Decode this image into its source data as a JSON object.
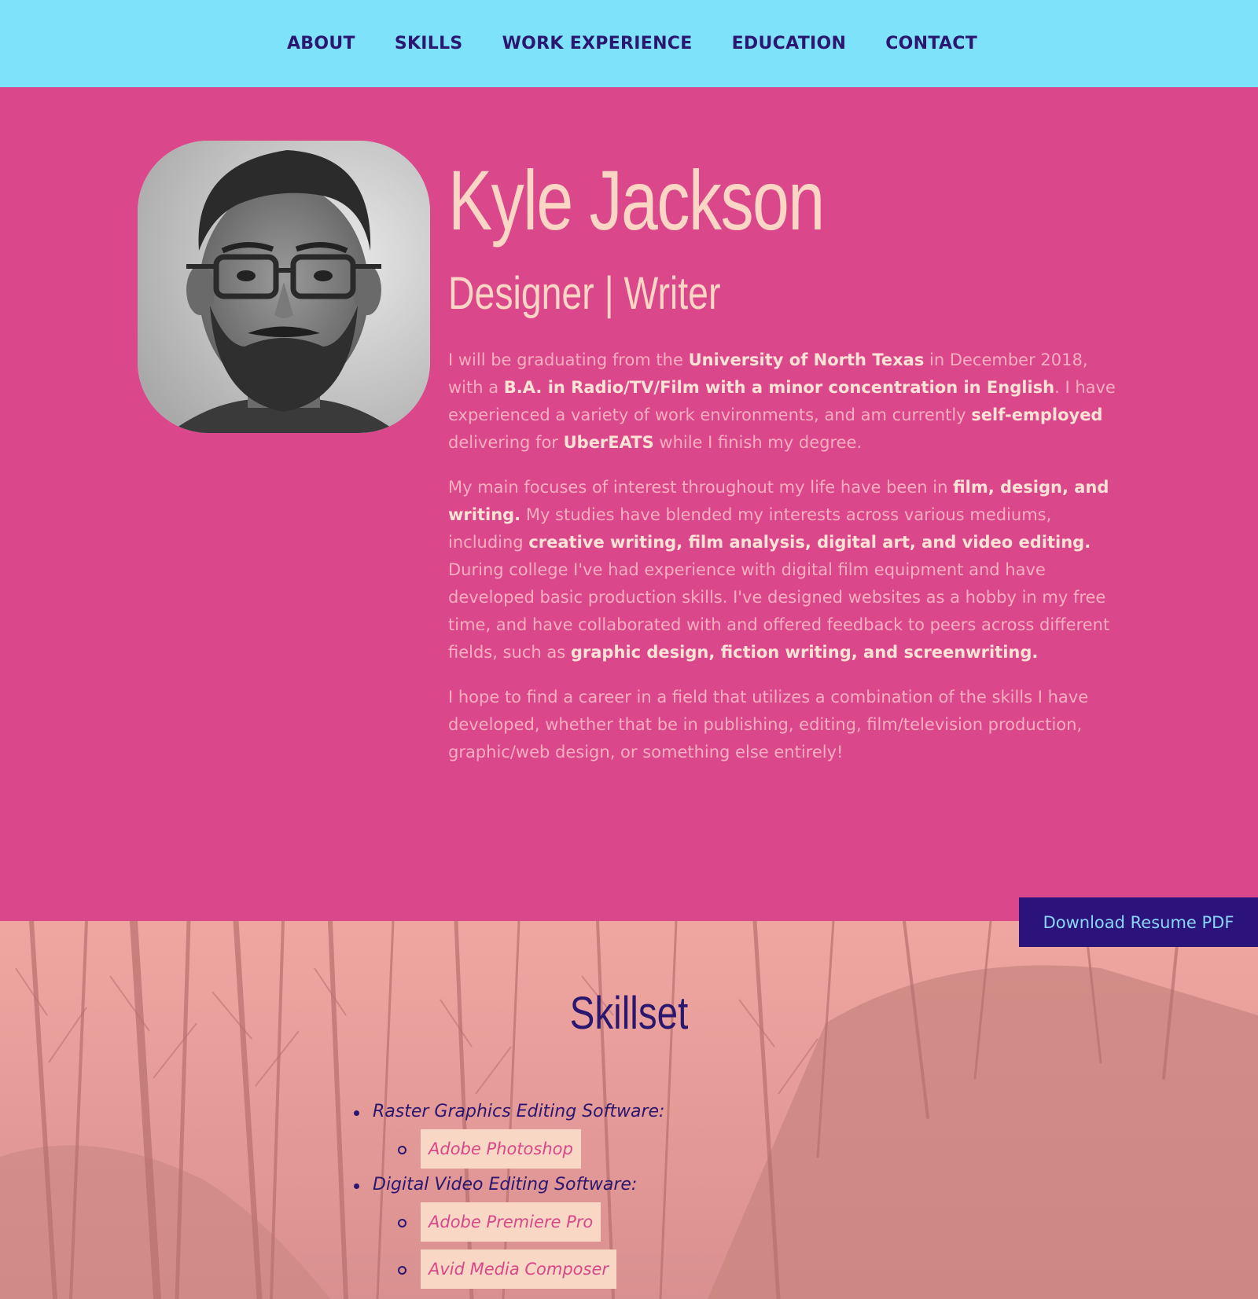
{
  "nav": {
    "items": [
      {
        "label": "ABOUT"
      },
      {
        "label": "SKILLS"
      },
      {
        "label": "WORK EXPERIENCE"
      },
      {
        "label": "EDUCATION"
      },
      {
        "label": "CONTACT"
      }
    ]
  },
  "hero": {
    "name": "Kyle Jackson",
    "tagline": "Designer | Writer",
    "bio": {
      "p1": [
        {
          "t": "I will be graduating from the ",
          "b": false
        },
        {
          "t": "University of North Texas",
          "b": true
        },
        {
          "t": " in December 2018, with a ",
          "b": false
        },
        {
          "t": "B.A. in Radio/TV/Film with a minor concentration in English",
          "b": true
        },
        {
          "t": ". I have experienced a variety of work environments, and am currently ",
          "b": false
        },
        {
          "t": "self-employed",
          "b": true
        },
        {
          "t": " delivering for ",
          "b": false
        },
        {
          "t": "UberEATS",
          "b": true
        },
        {
          "t": " while I finish my degree.",
          "b": false
        }
      ],
      "p2": [
        {
          "t": "My main focuses of interest throughout my life have been in ",
          "b": false
        },
        {
          "t": "film, design, and writing.",
          "b": true
        },
        {
          "t": " My studies have blended my interests across various mediums, including ",
          "b": false
        },
        {
          "t": "creative writing, film analysis, digital art, and video editing.",
          "b": true
        },
        {
          "t": " During college I've had experience with digital film equipment and have developed basic production skills. I've designed websites as a hobby in my free time, and have collaborated with and offered feedback to peers across different fields, such as ",
          "b": false
        },
        {
          "t": "graphic design, fiction writing, and screenwriting.",
          "b": true
        }
      ],
      "p3": [
        {
          "t": "I hope to find a career in a field that utilizes a combination of the skills I have developed, whether that be in publishing, editing, film/television production, graphic/web design, or something else entirely!",
          "b": false
        }
      ]
    }
  },
  "resume_button": "Download Resume PDF",
  "skills": {
    "title": "Skillset",
    "categories": [
      {
        "label": "Raster Graphics Editing Software:",
        "items": [
          "Adobe Photoshop"
        ]
      },
      {
        "label": "Digital Video Editing Software:",
        "items": [
          "Adobe Premiere Pro",
          "Avid Media Composer"
        ]
      }
    ]
  },
  "colors": {
    "nav_bg": "#7de2fa",
    "nav_text": "#2b1670",
    "hero_bg": "#da478a",
    "hero_text": "#fbd6c4",
    "button_bg": "#2c137c",
    "button_text": "#8ad6ff",
    "chip_bg": "#f8d7c4",
    "chip_text": "#d74889"
  }
}
